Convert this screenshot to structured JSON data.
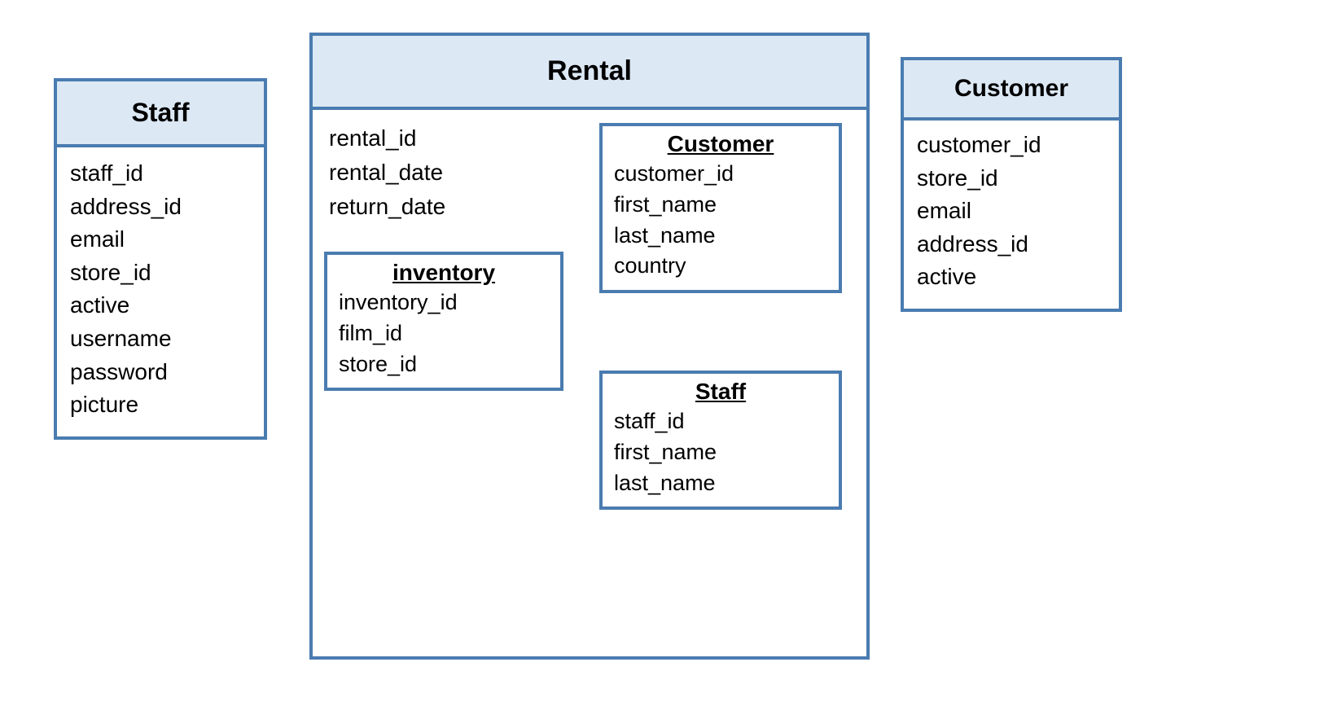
{
  "entities": {
    "staff": {
      "title": "Staff",
      "attrs": [
        "staff_id",
        "address_id",
        "email",
        "store_id",
        "active",
        "username",
        "password",
        "picture"
      ]
    },
    "rental": {
      "title": "Rental",
      "attrs": [
        "rental_id",
        "rental_date",
        "return_date"
      ],
      "inner": {
        "customer": {
          "title": "Customer",
          "attrs": [
            "customer_id",
            "first_name",
            "last_name",
            "country"
          ]
        },
        "inventory": {
          "title": "inventory",
          "attrs": [
            "inventory_id",
            "film_id",
            "store_id"
          ]
        },
        "staff": {
          "title": "Staff",
          "attrs": [
            "staff_id",
            "first_name",
            "last_name"
          ]
        }
      }
    },
    "customer": {
      "title": "Customer",
      "attrs": [
        "customer_id",
        "store_id",
        "email",
        "address_id",
        "active"
      ]
    }
  },
  "colors": {
    "border": "#4a7cb0",
    "header_bg": "#dce8f4"
  }
}
